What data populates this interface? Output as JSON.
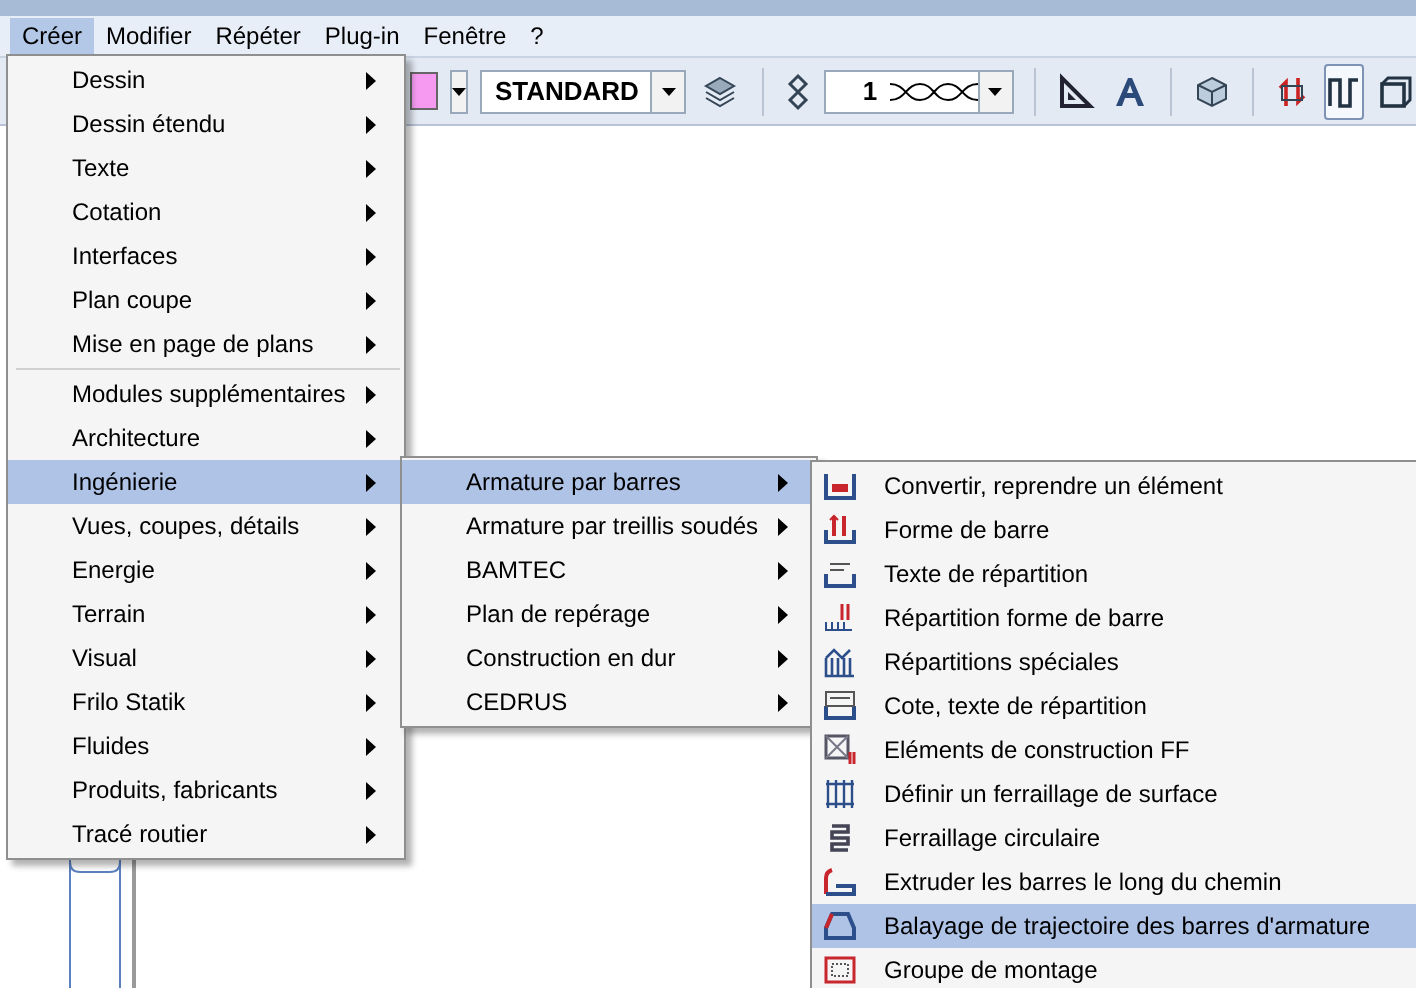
{
  "menubar": [
    {
      "label": "Créer",
      "selected": true
    },
    {
      "label": "Modifier",
      "selected": false
    },
    {
      "label": "Répéter",
      "selected": false
    },
    {
      "label": "Plug-in",
      "selected": false
    },
    {
      "label": "Fenêtre",
      "selected": false
    },
    {
      "label": "?",
      "selected": false
    }
  ],
  "toolbar": {
    "pen_combo": "STANDARD",
    "line_combo": "1",
    "color": "#f59af0"
  },
  "menu": [
    {
      "kind": "item",
      "label": "Dessin",
      "selected": false
    },
    {
      "kind": "item",
      "label": "Dessin étendu",
      "selected": false
    },
    {
      "kind": "item",
      "label": "Texte",
      "selected": false
    },
    {
      "kind": "item",
      "label": "Cotation",
      "selected": false
    },
    {
      "kind": "item",
      "label": "Interfaces",
      "selected": false
    },
    {
      "kind": "item",
      "label": "Plan coupe",
      "selected": false
    },
    {
      "kind": "item",
      "label": "Mise en page de plans",
      "selected": false
    },
    {
      "kind": "separator"
    },
    {
      "kind": "item",
      "label": "Modules supplémentaires",
      "selected": false
    },
    {
      "kind": "item",
      "label": "Architecture",
      "selected": false
    },
    {
      "kind": "item",
      "label": "Ingénierie",
      "selected": true
    },
    {
      "kind": "item",
      "label": "Vues, coupes, détails",
      "selected": false
    },
    {
      "kind": "item",
      "label": "Energie",
      "selected": false
    },
    {
      "kind": "item",
      "label": "Terrain",
      "selected": false
    },
    {
      "kind": "item",
      "label": "Visual",
      "selected": false
    },
    {
      "kind": "item",
      "label": "Frilo Statik",
      "selected": false
    },
    {
      "kind": "item",
      "label": "Fluides",
      "selected": false
    },
    {
      "kind": "item",
      "label": "Produits, fabricants",
      "selected": false
    },
    {
      "kind": "item",
      "label": "Tracé routier",
      "selected": false
    }
  ],
  "submenu": [
    {
      "label": "Armature par barres",
      "selected": true
    },
    {
      "label": "Armature par treillis soudés",
      "selected": false
    },
    {
      "label": "BAMTEC",
      "selected": false
    },
    {
      "label": "Plan de repérage",
      "selected": false
    },
    {
      "label": "Construction en dur",
      "selected": false
    },
    {
      "label": "CEDRUS",
      "selected": false
    }
  ],
  "commands": [
    {
      "label": "Convertir, reprendre un élément",
      "selected": false
    },
    {
      "label": "Forme de barre",
      "selected": false
    },
    {
      "label": "Texte de répartition",
      "selected": false
    },
    {
      "label": "Répartition forme de barre",
      "selected": false
    },
    {
      "label": "Répartitions spéciales",
      "selected": false
    },
    {
      "label": "Cote, texte de répartition",
      "selected": false
    },
    {
      "label": "Eléments de construction FF",
      "selected": false
    },
    {
      "label": "Définir un ferraillage de surface",
      "selected": false
    },
    {
      "label": "Ferraillage circulaire",
      "selected": false
    },
    {
      "label": "Extruder les barres le long du chemin",
      "selected": false
    },
    {
      "label": "Balayage de trajectoire des barres d'armature",
      "selected": true
    },
    {
      "label": "Groupe de montage",
      "selected": false
    }
  ]
}
